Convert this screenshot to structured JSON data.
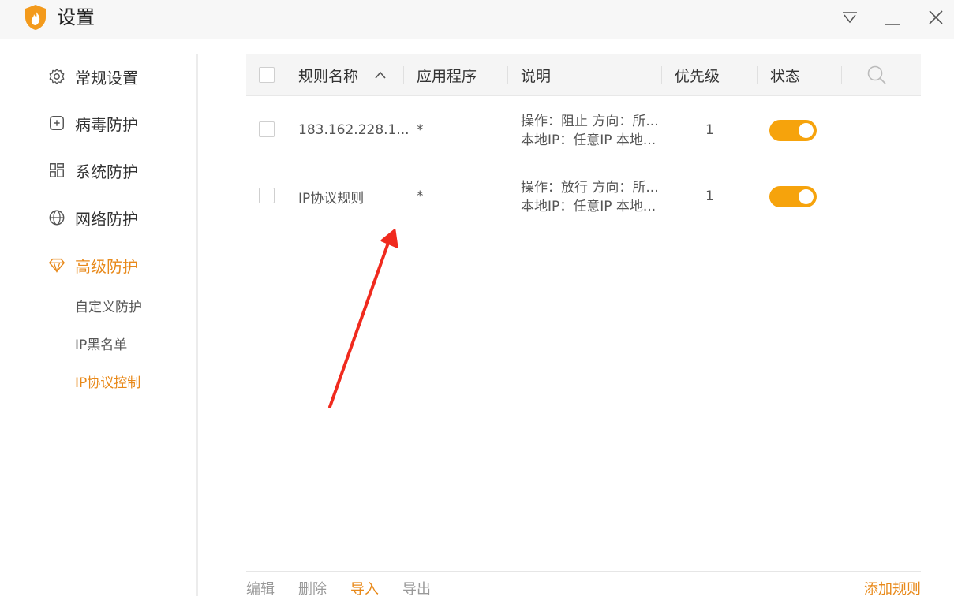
{
  "window": {
    "title": "设置",
    "controls": [
      "dropdown-icon",
      "minimize-icon",
      "close-icon"
    ]
  },
  "sidebar": {
    "items": [
      {
        "label": "常规设置",
        "icon": "gear-icon",
        "active": false
      },
      {
        "label": "病毒防护",
        "icon": "plus-square-icon",
        "active": false
      },
      {
        "label": "系统防护",
        "icon": "grid-icon",
        "active": false
      },
      {
        "label": "网络防护",
        "icon": "globe-icon",
        "active": false
      },
      {
        "label": "高级防护",
        "icon": "diamond-icon",
        "active": true
      }
    ],
    "sub_items": [
      {
        "label": "自定义防护",
        "active": false
      },
      {
        "label": "IP黑名单",
        "active": false
      },
      {
        "label": "IP协议控制",
        "active": true
      }
    ]
  },
  "table": {
    "headers": {
      "name": "规则名称",
      "app": "应用程序",
      "desc": "说明",
      "priority": "优先级",
      "status": "状态"
    },
    "rows": [
      {
        "name": "183.162.228.1...",
        "app": "*",
        "desc_line1": "操作：阻止 方向：所...",
        "desc_line2": "本地IP：任意IP 本地...",
        "priority": "1",
        "enabled": true
      },
      {
        "name": "IP协议规则",
        "app": "*",
        "desc_line1": "操作：放行 方向：所...",
        "desc_line2": "本地IP：任意IP 本地...",
        "priority": "1",
        "enabled": true
      }
    ]
  },
  "footer": {
    "edit": "编辑",
    "delete": "删除",
    "import": "导入",
    "export": "导出",
    "add_rule": "添加规则"
  },
  "colors": {
    "accent": "#e8891a",
    "toggle_on": "#f6a30c",
    "annotation_arrow": "#f02a1e"
  }
}
